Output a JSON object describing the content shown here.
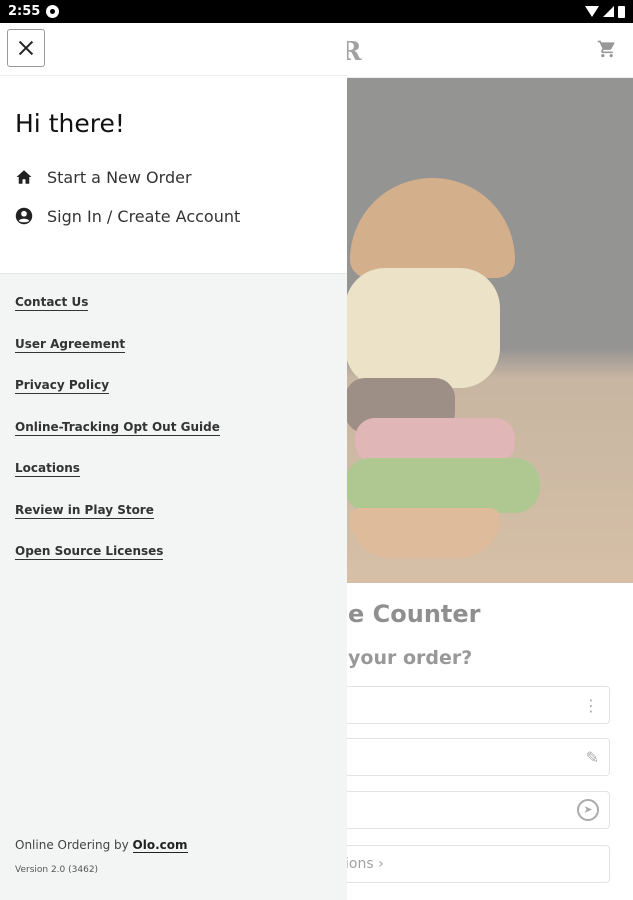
{
  "status_bar": {
    "time": "2:55"
  },
  "background": {
    "title_partial": "e Counter",
    "question_partial": "your order?",
    "options_partial": "ions",
    "field3_icon": "navigation-icon"
  },
  "drawer": {
    "greeting": "Hi there!",
    "menu": [
      {
        "label": "Start a New Order",
        "icon": "home-icon"
      },
      {
        "label": "Sign In / Create Account",
        "icon": "account-circle-icon"
      }
    ],
    "links": [
      "Contact Us",
      "User Agreement",
      "Privacy Policy",
      "Online-Tracking Opt Out Guide",
      "Locations",
      "Review in Play Store",
      "Open Source Licenses"
    ],
    "footer": {
      "prefix": "Online Ordering by ",
      "link": "Olo.com"
    },
    "version": "Version 2.0 (3462)"
  }
}
